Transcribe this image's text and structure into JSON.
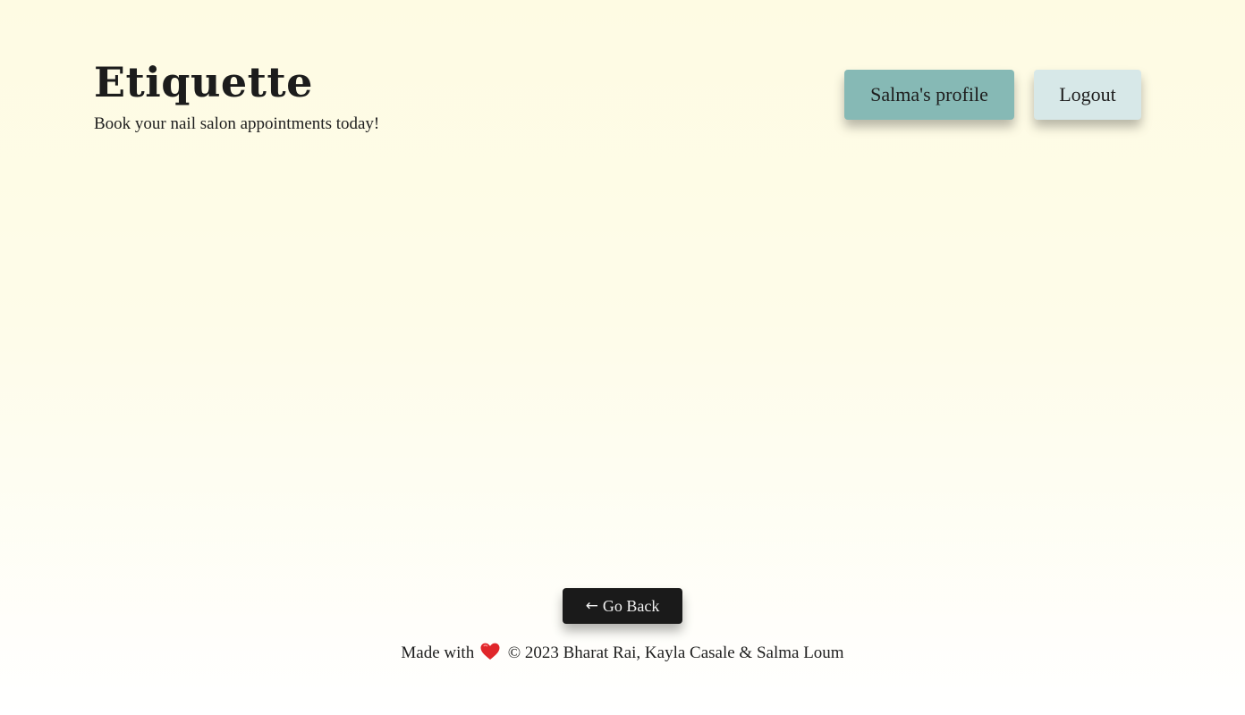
{
  "header": {
    "title": "Etiquette",
    "tagline": "Book your nail salon appointments today!"
  },
  "nav": {
    "profile_label": "Salma's profile",
    "logout_label": "Logout"
  },
  "main": {
    "go_back_arrow": "←",
    "go_back_label": "Go Back"
  },
  "footer": {
    "made_with": "Made with",
    "heart_icon": "heart-icon",
    "credits": "© 2023 Bharat Rai, Kayla Casale & Salma Loum"
  },
  "colors": {
    "background_top": "#fefbe3",
    "profile_button": "#86b9b5",
    "logout_button": "#d7e8e8",
    "go_back_button": "#1a1a1a",
    "heart": "#e0262a"
  }
}
